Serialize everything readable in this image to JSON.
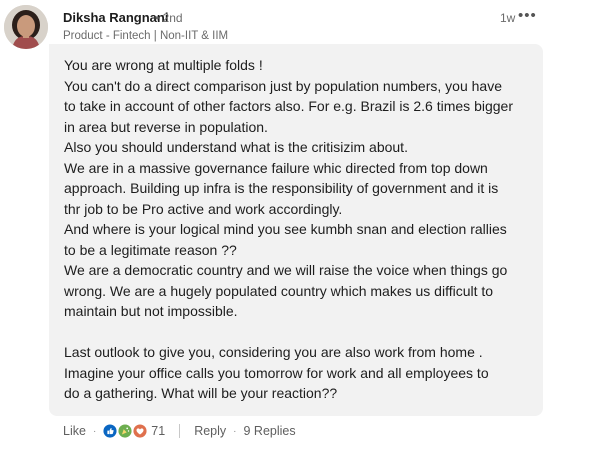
{
  "comment": {
    "author": {
      "name": "Diksha Rangnani",
      "degree": "• 2nd",
      "headline": "Product - Fintech | Non-IIT & IIM"
    },
    "time": "1w",
    "more_icon": "•••",
    "lines": [
      "You are wrong at multiple folds !",
      "You can't do a direct comparison just by population numbers, you have",
      "to take in account of other factors also. For e.g. Brazil is 2.6 times bigger",
      "in area but reverse in population.",
      "Also you should understand what is the critisizim about.",
      "We are in a massive governance failure whic directed from top down",
      "approach. Building up infra is the responsibility of government and it is",
      "thr job to be Pro active and work accordingly.",
      "And where is your logical mind you see kumbh snan and election rallies",
      "to be a legitimate reason ??",
      "We are a democratic country and we will raise the voice when things go",
      "wrong. We are a hugely populated country which makes us difficult to",
      "maintain but not impossible.",
      "",
      "Last outlook to give you, considering you are also work from home .",
      "Imagine your office calls you tomorrow for work and all employees to",
      "do a gathering. What will be your reaction??"
    ]
  },
  "actions": {
    "like": "Like",
    "bullet": "·",
    "reaction_count": "71",
    "reply": "Reply",
    "replies": "9 Replies"
  },
  "colors": {
    "like_reaction": "#0a66c2",
    "celebrate_reaction": "#6dae4f",
    "love_reaction": "#df704d",
    "bubble": "#f2f2f2"
  }
}
